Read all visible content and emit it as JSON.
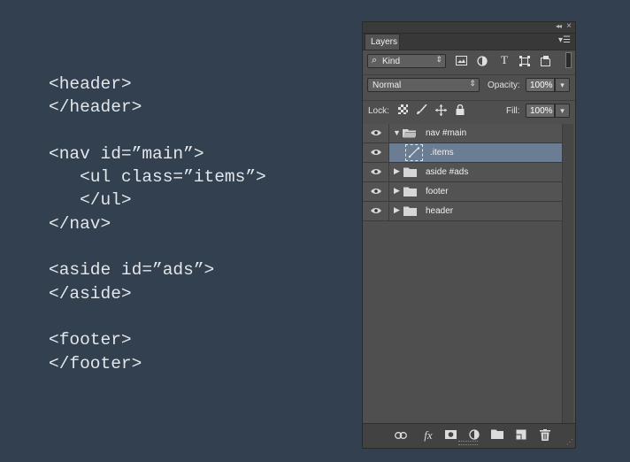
{
  "code_lines": [
    "<header>",
    "</header>",
    "",
    "<nav id=”main”>",
    "   <ul class=”items”>",
    "   </ul>",
    "</nav>",
    "",
    "<aside id=”ads”>",
    "</aside>",
    "",
    "<footer>",
    "</footer>"
  ],
  "panel": {
    "collapse_glyph": "◂◂",
    "close_glyph": "×",
    "tab_label": "Layers",
    "menu_glyph": "▾☰",
    "filter": {
      "icon": "search-icon",
      "label": "Kind",
      "search_glyph": "⌕"
    },
    "filter_icons": [
      "image-filter-icon",
      "adjustment-filter-icon",
      "type-filter-icon",
      "shape-filter-icon",
      "smart-object-filter-icon"
    ],
    "blend_mode": "Normal",
    "opacity_label": "Opacity:",
    "opacity_value": "100%",
    "lock_label": "Lock:",
    "fill_label": "Fill:",
    "fill_value": "100%",
    "layers": [
      {
        "name": "nav #main",
        "type": "group",
        "expanded": true,
        "selected": false,
        "visible": true
      },
      {
        "name": ".items",
        "type": "shape",
        "expanded": false,
        "selected": true,
        "visible": true
      },
      {
        "name": "aside #ads",
        "type": "group",
        "expanded": false,
        "selected": false,
        "visible": true
      },
      {
        "name": "footer",
        "type": "group",
        "expanded": false,
        "selected": false,
        "visible": true
      },
      {
        "name": "header",
        "type": "group",
        "expanded": false,
        "selected": false,
        "visible": true
      }
    ],
    "footer_icons": [
      "link-icon",
      "fx-icon",
      "mask-icon",
      "adjustment-icon",
      "new-group-icon",
      "new-layer-icon",
      "trash-icon"
    ],
    "fx_label": "fx",
    "selection_color": "#6b7d92"
  }
}
